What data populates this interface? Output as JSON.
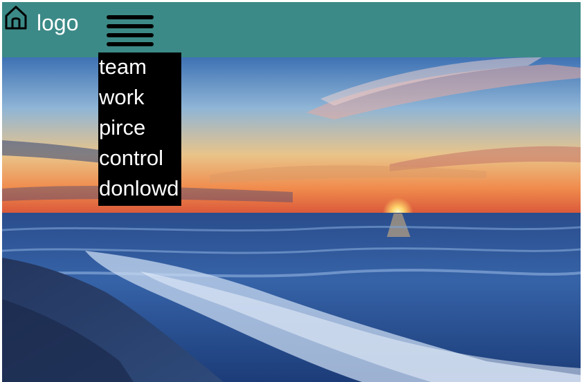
{
  "header": {
    "home_icon": "home-icon",
    "logo_text": "logo",
    "menu_icon": "hamburger-menu-icon",
    "background_color": "#3c8a87"
  },
  "nav": {
    "items": [
      {
        "label": "team"
      },
      {
        "label": "work"
      },
      {
        "label": "pirce"
      },
      {
        "label": "control"
      },
      {
        "label": "donlowd"
      }
    ],
    "background_color": "#000000",
    "text_color": "#ffffff"
  },
  "hero": {
    "image": "sunset-beach-photo"
  }
}
